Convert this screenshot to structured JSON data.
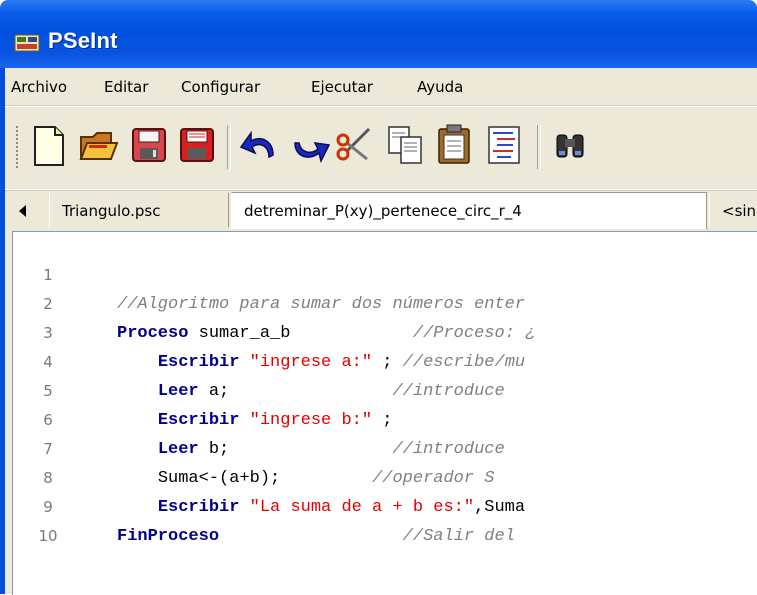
{
  "window": {
    "title": "PSeInt"
  },
  "menu": {
    "items": [
      "Archivo",
      "Editar",
      "Configurar",
      "Ejecutar",
      "Ayuda"
    ]
  },
  "toolbar": {
    "buttons": [
      "new-file-icon",
      "open-folder-icon",
      "save-icon",
      "save-as-icon",
      "undo-icon",
      "redo-icon",
      "cut-icon",
      "copy-icon",
      "paste-icon",
      "indent-icon",
      "find-icon"
    ]
  },
  "tabs": {
    "items": [
      "Triangulo.psc",
      "detreminar_P(xy)_pertenece_circ_r_4",
      "<sin"
    ]
  },
  "editor": {
    "line_numbers": [
      "1",
      "2",
      "3",
      "4",
      "5",
      "6",
      "7",
      "8",
      "9",
      "10"
    ],
    "lines": [
      {
        "indent": "",
        "kw": "",
        "rest": "",
        "str": "",
        "tail": "",
        "pad": "",
        "cmt": "//Algoritmo para sumar dos números enter"
      },
      {
        "indent": "",
        "kw": "Proceso",
        "rest": " sumar_a_b",
        "str": "",
        "tail": "",
        "pad": "            ",
        "cmt": "//Proceso: ¿"
      },
      {
        "indent": "    ",
        "kw": "Escribir",
        "rest": " ",
        "str": "\"ingrese a:\"",
        "tail": " ; ",
        "pad": "",
        "cmt": "//escribe/mu"
      },
      {
        "indent": "    ",
        "kw": "Leer",
        "rest": " a;",
        "str": "",
        "tail": "",
        "pad": "                ",
        "cmt": "//introduce"
      },
      {
        "indent": "    ",
        "kw": "Escribir",
        "rest": " ",
        "str": "\"ingrese b:\"",
        "tail": " ;",
        "pad": "",
        "cmt": ""
      },
      {
        "indent": "    ",
        "kw": "Leer",
        "rest": " b;",
        "str": "",
        "tail": "",
        "pad": "                ",
        "cmt": "//introduce"
      },
      {
        "indent": "    ",
        "kw": "",
        "rest": "Suma<-(a+b);",
        "str": "",
        "tail": "",
        "pad": "         ",
        "cmt": "//operador S"
      },
      {
        "indent": "    ",
        "kw": "Escribir",
        "rest": " ",
        "str": "\"La suma de a + b es:\"",
        "tail": ",Suma",
        "pad": "",
        "cmt": ""
      },
      {
        "indent": "",
        "kw": "FinProceso",
        "rest": "",
        "str": "",
        "tail": "",
        "pad": "                  ",
        "cmt": "//Salir del"
      },
      {
        "indent": "",
        "kw": "",
        "rest": "",
        "str": "",
        "tail": "",
        "pad": "",
        "cmt": ""
      }
    ]
  }
}
